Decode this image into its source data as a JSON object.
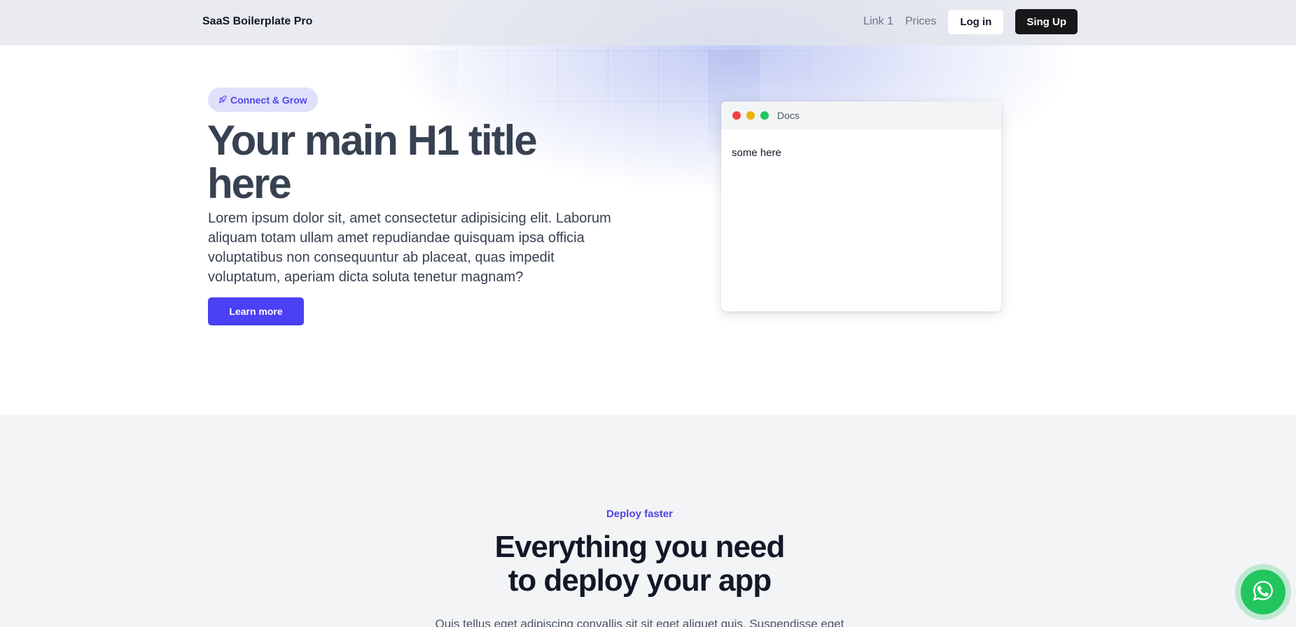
{
  "nav": {
    "brand": "SaaS Boilerplate Pro",
    "links": [
      "Link 1",
      "Prices"
    ],
    "login_label": "Log in",
    "signup_label": "Sing Up"
  },
  "hero": {
    "badge_icon": "rocket-icon",
    "badge_label": "Connect & Grow",
    "title": "Your main H1 title here",
    "lead": "Lorem ipsum dolor sit, amet consectetur adipisicing elit. Laborum aliquam totam ullam amet repudiandae quisquam ipsa officia voluptatibus non consequuntur ab placeat, quas impedit voluptatum, aperiam dicta soluta tenetur magnam?",
    "cta_label": "Learn more"
  },
  "docs_window": {
    "title": "Docs",
    "body": "some here"
  },
  "features": {
    "eyebrow": "Deploy faster",
    "title_line1": "Everything you need",
    "title_line2": "to deploy your app",
    "subtext": "Quis tellus eget adipiscing convallis sit sit eget aliquet quis. Suspendisse eget"
  },
  "floating": {
    "icon": "whatsapp-icon"
  },
  "colors": {
    "accent": "#4a40f4",
    "badge_bg": "#e0e0fb",
    "signup_bg": "#18181b",
    "whatsapp": "#22c55e"
  }
}
